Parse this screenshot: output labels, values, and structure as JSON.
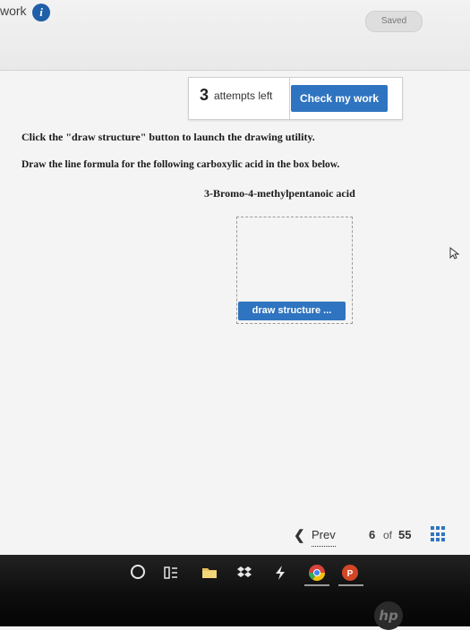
{
  "header": {
    "title": "work",
    "info_icon": "info-icon",
    "save_status": "Saved"
  },
  "attempts": {
    "count": "3",
    "label": "attempts left",
    "check_button": "Check my work"
  },
  "question": {
    "instruction_1": "Click the \"draw structure\" button to launch the drawing utility.",
    "instruction_2": "Draw the line formula for the following carboxylic acid in the box below.",
    "compound_name": "3-Bromo-4-methylpentanoic acid",
    "draw_button": "draw structure ..."
  },
  "pager": {
    "prev_label": "Prev",
    "current_page": "6",
    "of_label": "of",
    "total_pages": "55"
  },
  "taskbar": {
    "icons": [
      "launcher-circle-icon",
      "task-view-icon",
      "files-folder-icon",
      "dropbox-icon",
      "bolt-icon",
      "chrome-icon",
      "powerpoint-icon"
    ],
    "brand": "hp"
  },
  "colors": {
    "accent_blue": "#2f74c0",
    "info_blue": "#1f5fa8",
    "taskbar_dark": "#0c0c0c"
  }
}
